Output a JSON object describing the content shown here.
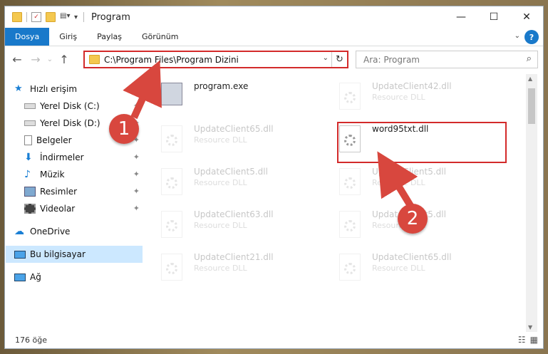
{
  "window": {
    "title": "Program"
  },
  "window_controls": {
    "minimize": "—",
    "maximize": "☐",
    "close": "✕"
  },
  "ribbon": {
    "tabs": [
      {
        "label": "Dosya"
      },
      {
        "label": "Giriş"
      },
      {
        "label": "Paylaş"
      },
      {
        "label": "Görünüm"
      }
    ],
    "help": "?"
  },
  "address": {
    "path": "C:\\Program Files\\Program Dizini"
  },
  "search": {
    "placeholder": "Ara: Program"
  },
  "nav": {
    "items": [
      {
        "label": "Hızlı erişim"
      },
      {
        "label": "Yerel Disk (C:)"
      },
      {
        "label": "Yerel Disk (D:)"
      },
      {
        "label": "Belgeler"
      },
      {
        "label": "İndirmeler"
      },
      {
        "label": "Müzik"
      },
      {
        "label": "Resimler"
      },
      {
        "label": "Videolar"
      },
      {
        "label": "OneDrive"
      },
      {
        "label": "Bu bilgisayar"
      },
      {
        "label": "Ağ"
      }
    ]
  },
  "files": [
    {
      "name": "program.exe",
      "type": ""
    },
    {
      "name": "UpdateClient42.dll",
      "type": "Resource DLL"
    },
    {
      "name": "UpdateClient65.dll",
      "type": "Resource DLL"
    },
    {
      "name": "word95txt.dll",
      "type": ""
    },
    {
      "name": "UpdateClient5.dll",
      "type": "Resource DLL"
    },
    {
      "name": "UpdateClient5.dll",
      "type": "Resource DLL"
    },
    {
      "name": "UpdateClient63.dll",
      "type": "Resource DLL"
    },
    {
      "name": "UpdateClient5.dll",
      "type": "Resource DLL"
    },
    {
      "name": "UpdateClient21.dll",
      "type": "Resource DLL"
    },
    {
      "name": "UpdateClient65.dll",
      "type": "Resource DLL"
    }
  ],
  "status": {
    "count": "176 öğe"
  },
  "annotations": {
    "step1": "1",
    "step2": "2"
  },
  "colors": {
    "highlight": "#d32a2a",
    "badge": "#d8473e",
    "file_tab": "#1979ca"
  }
}
